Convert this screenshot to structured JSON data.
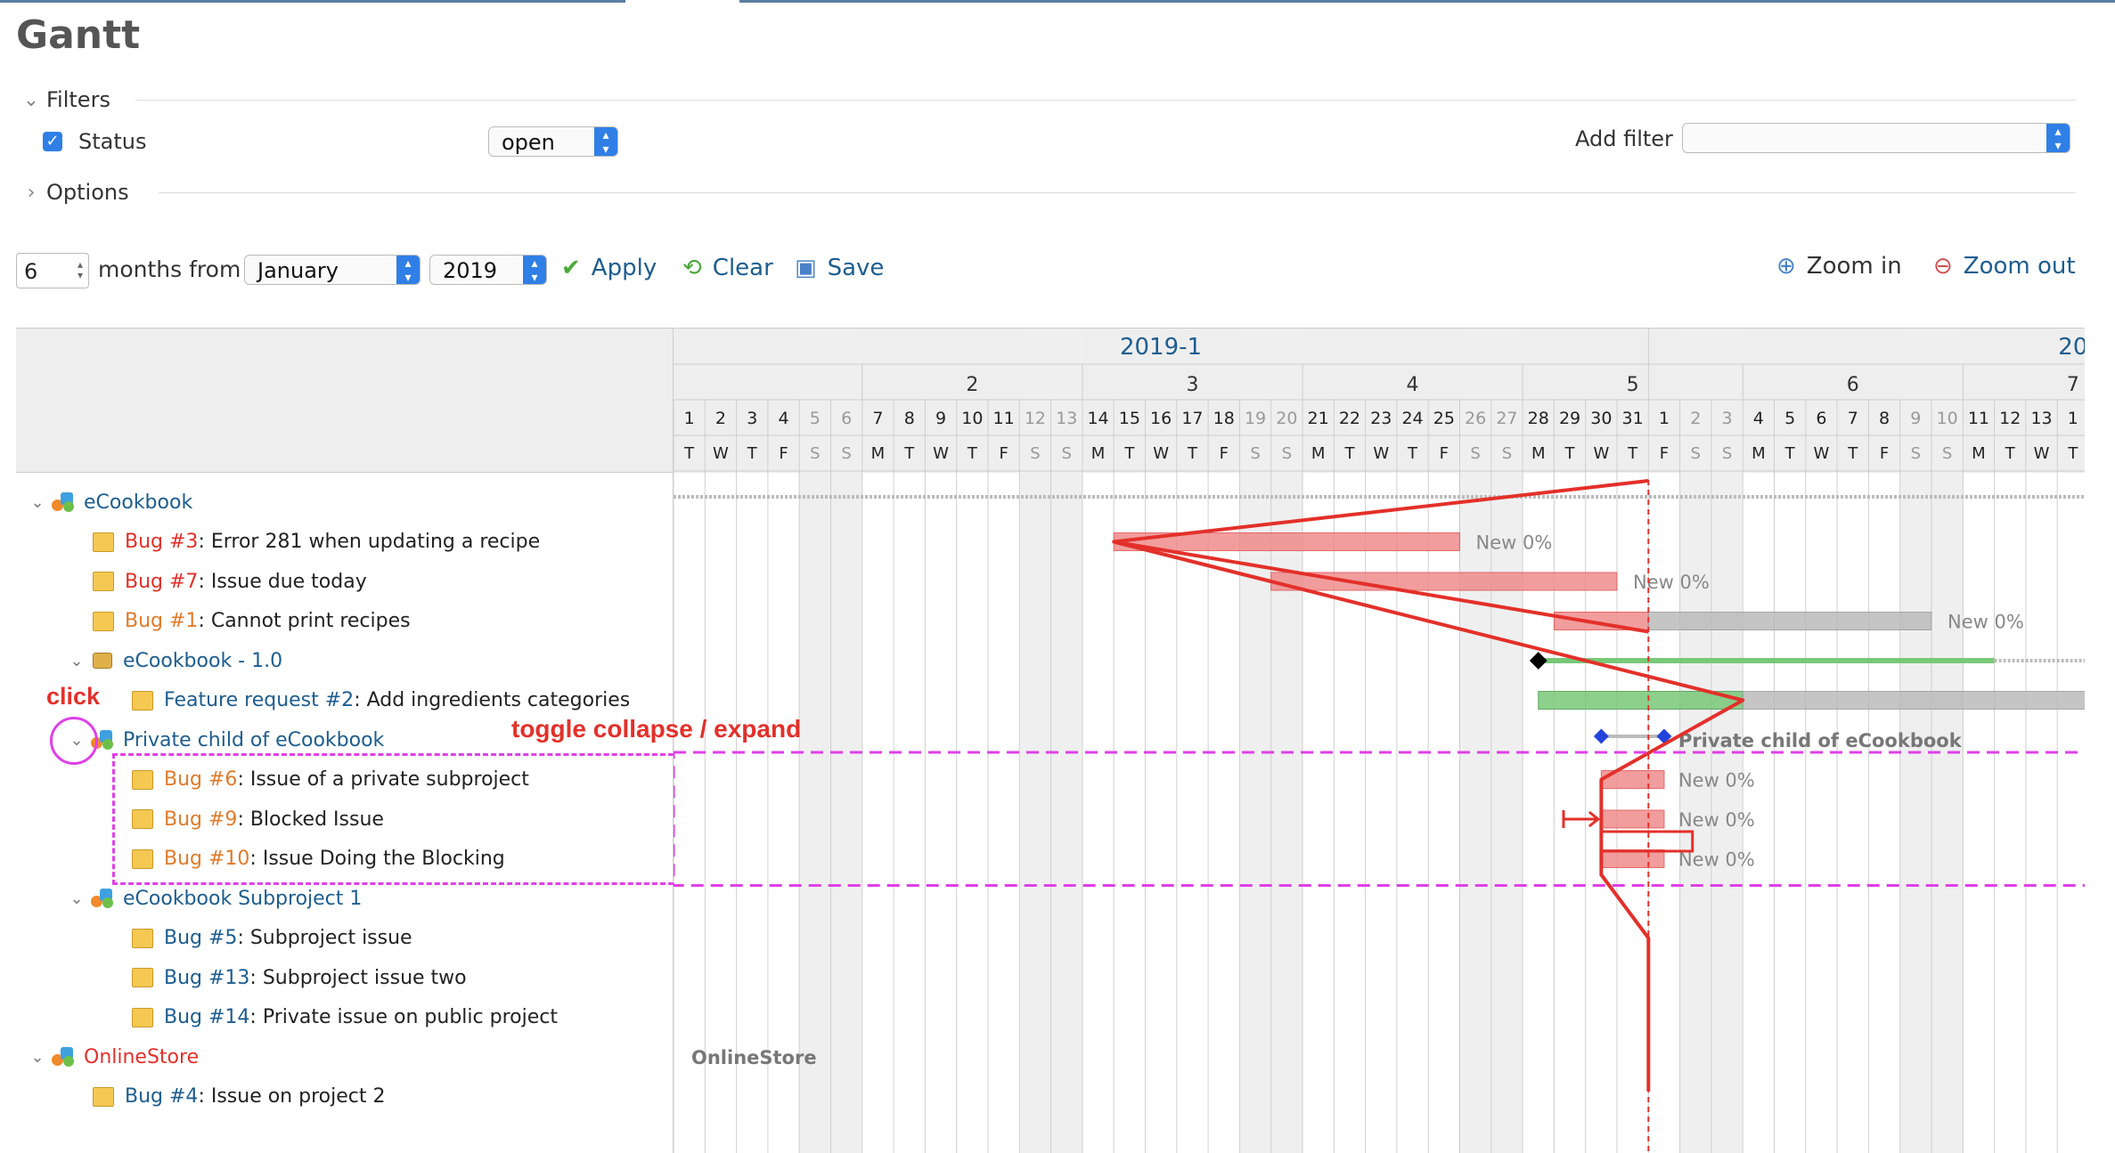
{
  "page": {
    "title": "Gantt"
  },
  "filters": {
    "section_label": "Filters",
    "status_label": "Status",
    "status_value": "open",
    "add_filter_label": "Add filter",
    "add_filter_value": ""
  },
  "options": {
    "section_label": "Options"
  },
  "toolbar": {
    "months_value": "6",
    "months_from_label": "months from",
    "month_value": "January",
    "year_value": "2019",
    "apply_label": "Apply",
    "clear_label": "Clear",
    "save_label": "Save",
    "zoom_in_label": "Zoom in",
    "zoom_out_label": "Zoom out"
  },
  "timeline": {
    "month_labels": [
      "2019-1",
      "20"
    ],
    "week_labels": [
      "2",
      "3",
      "4",
      "5",
      "6",
      "7"
    ],
    "days": [
      "1",
      "2",
      "3",
      "4",
      "5",
      "6",
      "7",
      "8",
      "9",
      "10",
      "11",
      "12",
      "13",
      "14",
      "15",
      "16",
      "17",
      "18",
      "19",
      "20",
      "21",
      "22",
      "23",
      "24",
      "25",
      "26",
      "27",
      "28",
      "29",
      "30",
      "31",
      "1",
      "2",
      "3",
      "4",
      "5",
      "6",
      "7",
      "8",
      "9",
      "10",
      "11",
      "12",
      "13",
      "1"
    ],
    "weekdays": [
      "T",
      "W",
      "T",
      "F",
      "S",
      "S",
      "M",
      "T",
      "W",
      "T",
      "F",
      "S",
      "S",
      "M",
      "T",
      "W",
      "T",
      "F",
      "S",
      "S",
      "M",
      "T",
      "W",
      "T",
      "F",
      "S",
      "S",
      "M",
      "T",
      "W",
      "T",
      "F",
      "S",
      "S",
      "M",
      "T",
      "W",
      "T",
      "F",
      "S",
      "S",
      "M",
      "T",
      "W",
      "T"
    ]
  },
  "rows": [
    {
      "type": "project",
      "level": 0,
      "toggle": true,
      "name": "eCookbook",
      "color": "blue"
    },
    {
      "type": "issue",
      "level": 1,
      "tracker": "Bug #3",
      "tracker_color": "red",
      "subject": ": Error 281 when updating a recipe",
      "bar_label": "New 0%"
    },
    {
      "type": "issue",
      "level": 1,
      "tracker": "Bug #7",
      "tracker_color": "red",
      "subject": ": Issue due today",
      "bar_label": "New 0%"
    },
    {
      "type": "issue",
      "level": 1,
      "tracker": "Bug #1",
      "tracker_color": "orange",
      "subject": ": Cannot print recipes",
      "bar_label": "New 0%"
    },
    {
      "type": "version",
      "level": 1,
      "toggle": true,
      "name": "eCookbook - 1.0",
      "color": "blue"
    },
    {
      "type": "issue",
      "level": 2,
      "tracker": "Feature request #2",
      "tracker_color": "blue",
      "subject": ": Add ingredients categories",
      "bar_label": ""
    },
    {
      "type": "project",
      "level": 1,
      "toggle": true,
      "name": "Private child of eCookbook",
      "color": "blue",
      "bar_label": "Private child of eCookbook"
    },
    {
      "type": "issue",
      "level": 2,
      "tracker": "Bug #6",
      "tracker_color": "orange",
      "subject": ": Issue of a private subproject",
      "bar_label": "New 0%"
    },
    {
      "type": "issue",
      "level": 2,
      "tracker": "Bug #9",
      "tracker_color": "orange",
      "subject": ": Blocked Issue",
      "bar_label": "New 0%"
    },
    {
      "type": "issue",
      "level": 2,
      "tracker": "Bug #10",
      "tracker_color": "orange",
      "subject": ": Issue Doing the Blocking",
      "bar_label": "New 0%"
    },
    {
      "type": "project",
      "level": 1,
      "toggle": true,
      "name": "eCookbook Subproject 1",
      "color": "blue"
    },
    {
      "type": "issue",
      "level": 2,
      "tracker": "Bug #5",
      "tracker_color": "blue",
      "subject": ": Subproject issue"
    },
    {
      "type": "issue",
      "level": 2,
      "tracker": "Bug #13",
      "tracker_color": "blue",
      "subject": ": Subproject issue two"
    },
    {
      "type": "issue",
      "level": 2,
      "tracker": "Bug #14",
      "tracker_color": "blue",
      "subject": ": Private issue on public project"
    },
    {
      "type": "project",
      "level": 0,
      "toggle": true,
      "name": "OnlineStore",
      "color": "red",
      "bar_label": "OnlineStore"
    },
    {
      "type": "issue",
      "level": 1,
      "tracker": "Bug #4",
      "tracker_color": "blue",
      "subject": ": Issue on project 2"
    }
  ],
  "annotations": {
    "click_label": "click",
    "toggle_label": "toggle collapse / expand"
  },
  "colors": {
    "link": "#1d5d8f",
    "bug_red": "#e3302a",
    "bug_orange": "#e07b2a",
    "annotation_red": "#e3302a",
    "annotation_magenta": "#e040e8",
    "bar_late": "#f08c8c",
    "bar_green": "#78c878",
    "bar_grey": "#bbbbbb",
    "weekend": "#efefef"
  }
}
